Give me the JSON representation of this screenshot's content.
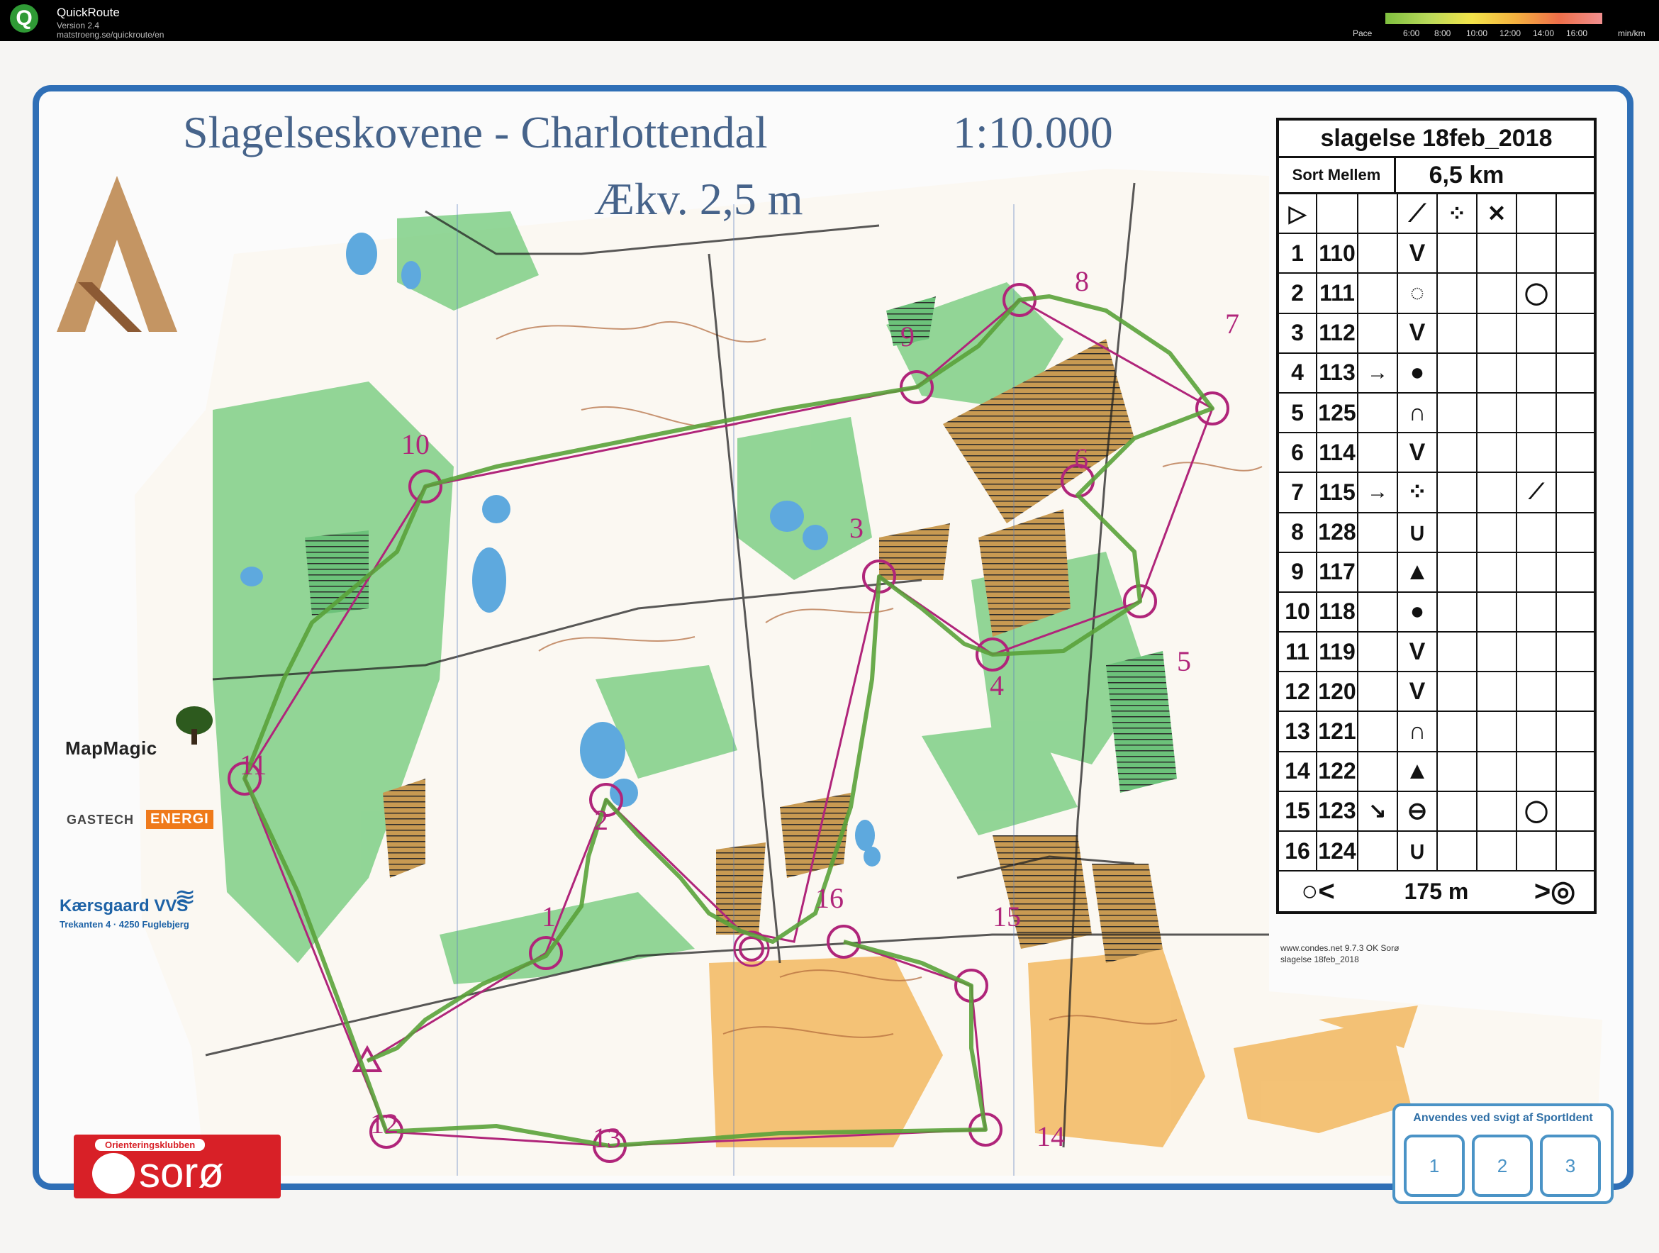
{
  "app": {
    "title": "QuickRoute",
    "version": "Version 2.4",
    "url": "matstroeng.se/quickroute/en",
    "logo_letter": "Q"
  },
  "pace_scale": {
    "label": "Pace",
    "ticks": [
      "6:00",
      "8:00",
      "10:00",
      "12:00",
      "14:00",
      "16:00"
    ],
    "unit": "min/km",
    "colors": [
      "#7fbf3f",
      "#b9d95a",
      "#f3e34a",
      "#f4b140",
      "#ee6f4a",
      "#f08f8f"
    ]
  },
  "map": {
    "title": "Slagelseskovene - Charlottendal",
    "scale": "1:10.000",
    "equidistance": "Ækv. 2,5 m",
    "frame_color": "#2f6fb6",
    "course_color": "#b0257a",
    "route_color": "#4f9a2e",
    "controls": [
      "1",
      "2",
      "3",
      "4",
      "5",
      "6",
      "7",
      "8",
      "9",
      "10",
      "11",
      "12",
      "13",
      "14",
      "15",
      "16"
    ]
  },
  "card": {
    "title": "slagelse 18feb_2018",
    "class": "Sort Mellem",
    "length": "6,5 km",
    "header_icons": [
      "start-triangle",
      "slope-line",
      "stony",
      "cross"
    ],
    "rows": [
      {
        "num": "1",
        "code": "110",
        "dir": "",
        "sym": "V",
        "misc": ""
      },
      {
        "num": "2",
        "code": "111",
        "dir": "",
        "sym": "◌",
        "misc": "◯"
      },
      {
        "num": "3",
        "code": "112",
        "dir": "",
        "sym": "V",
        "misc": ""
      },
      {
        "num": "4",
        "code": "113",
        "dir": "→",
        "sym": "●",
        "misc": ""
      },
      {
        "num": "5",
        "code": "125",
        "dir": "",
        "sym": "∩",
        "misc": ""
      },
      {
        "num": "6",
        "code": "114",
        "dir": "",
        "sym": "V",
        "misc": ""
      },
      {
        "num": "7",
        "code": "115",
        "dir": "→",
        "sym": "⁘",
        "misc": "⟋"
      },
      {
        "num": "8",
        "code": "128",
        "dir": "",
        "sym": "∪",
        "misc": ""
      },
      {
        "num": "9",
        "code": "117",
        "dir": "",
        "sym": "▲",
        "misc": ""
      },
      {
        "num": "10",
        "code": "118",
        "dir": "",
        "sym": "●",
        "misc": ""
      },
      {
        "num": "11",
        "code": "119",
        "dir": "",
        "sym": "V",
        "misc": ""
      },
      {
        "num": "12",
        "code": "120",
        "dir": "",
        "sym": "V",
        "misc": ""
      },
      {
        "num": "13",
        "code": "121",
        "dir": "",
        "sym": "∩",
        "misc": ""
      },
      {
        "num": "14",
        "code": "122",
        "dir": "",
        "sym": "▲",
        "misc": ""
      },
      {
        "num": "15",
        "code": "123",
        "dir": "↘",
        "sym": "⊖",
        "misc": "◯"
      },
      {
        "num": "16",
        "code": "124",
        "dir": "",
        "sym": "∪",
        "misc": ""
      }
    ],
    "finish_distance": "175 m",
    "finish_start_icon": "○<",
    "finish_end_icon": ">◎"
  },
  "condes": {
    "line1": "www.condes.net 9.7.3 OK Sorø",
    "line2": "slagelse 18feb_2018"
  },
  "backup": {
    "label": "Anvendes ved  svigt af SportIdent",
    "boxes": [
      "1",
      "2",
      "3"
    ]
  },
  "sponsors": {
    "mapmagic": "MapMagic",
    "gastech": "GASTECH",
    "energi": "ENERGI",
    "kaersgaard": "Kærsgaard VVS",
    "kaersgaard_sub": "Trekanten 4 · 4250 Fuglebjerg",
    "club_top": "Orienteringsklubben",
    "club_name": "sorø"
  }
}
